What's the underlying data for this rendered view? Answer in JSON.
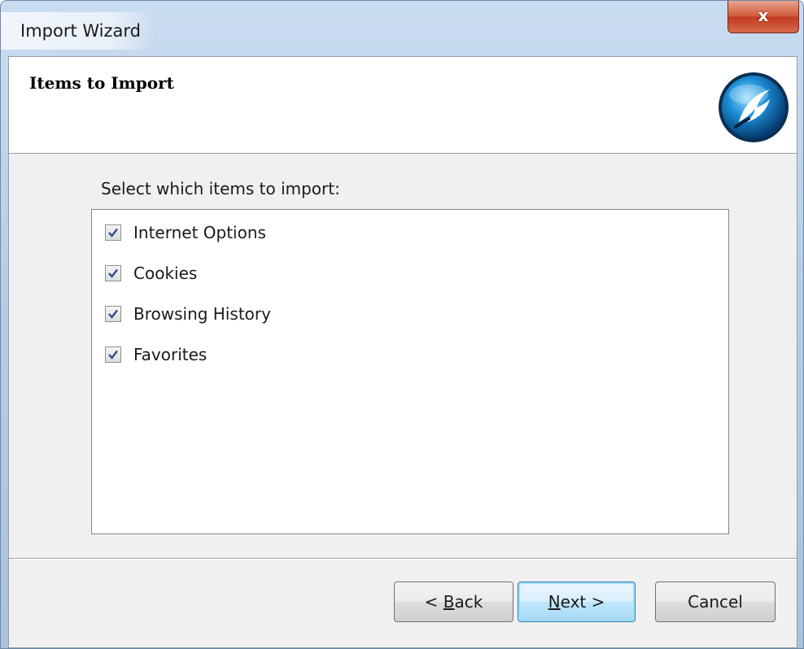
{
  "window": {
    "title": "Import Wizard",
    "close_label": "x"
  },
  "header": {
    "title": "Items to Import",
    "logo_icon": "app-logo-icon"
  },
  "instruction": "Select which items to import:",
  "items": [
    {
      "label": "Internet Options",
      "checked": true
    },
    {
      "label": "Cookies",
      "checked": true
    },
    {
      "label": "Browsing History",
      "checked": true
    },
    {
      "label": "Favorites",
      "checked": true
    }
  ],
  "buttons": {
    "back": {
      "prefix": "< ",
      "mnemonic": "B",
      "rest": "ack"
    },
    "next": {
      "prefix": "",
      "mnemonic": "N",
      "rest": "ext >"
    },
    "cancel": "Cancel"
  },
  "colors": {
    "titlebar": "#b6cde6",
    "close_button": "#c23b1f",
    "dialog_background": "#f0f0f0",
    "default_button_border": "#3c7fb1"
  }
}
